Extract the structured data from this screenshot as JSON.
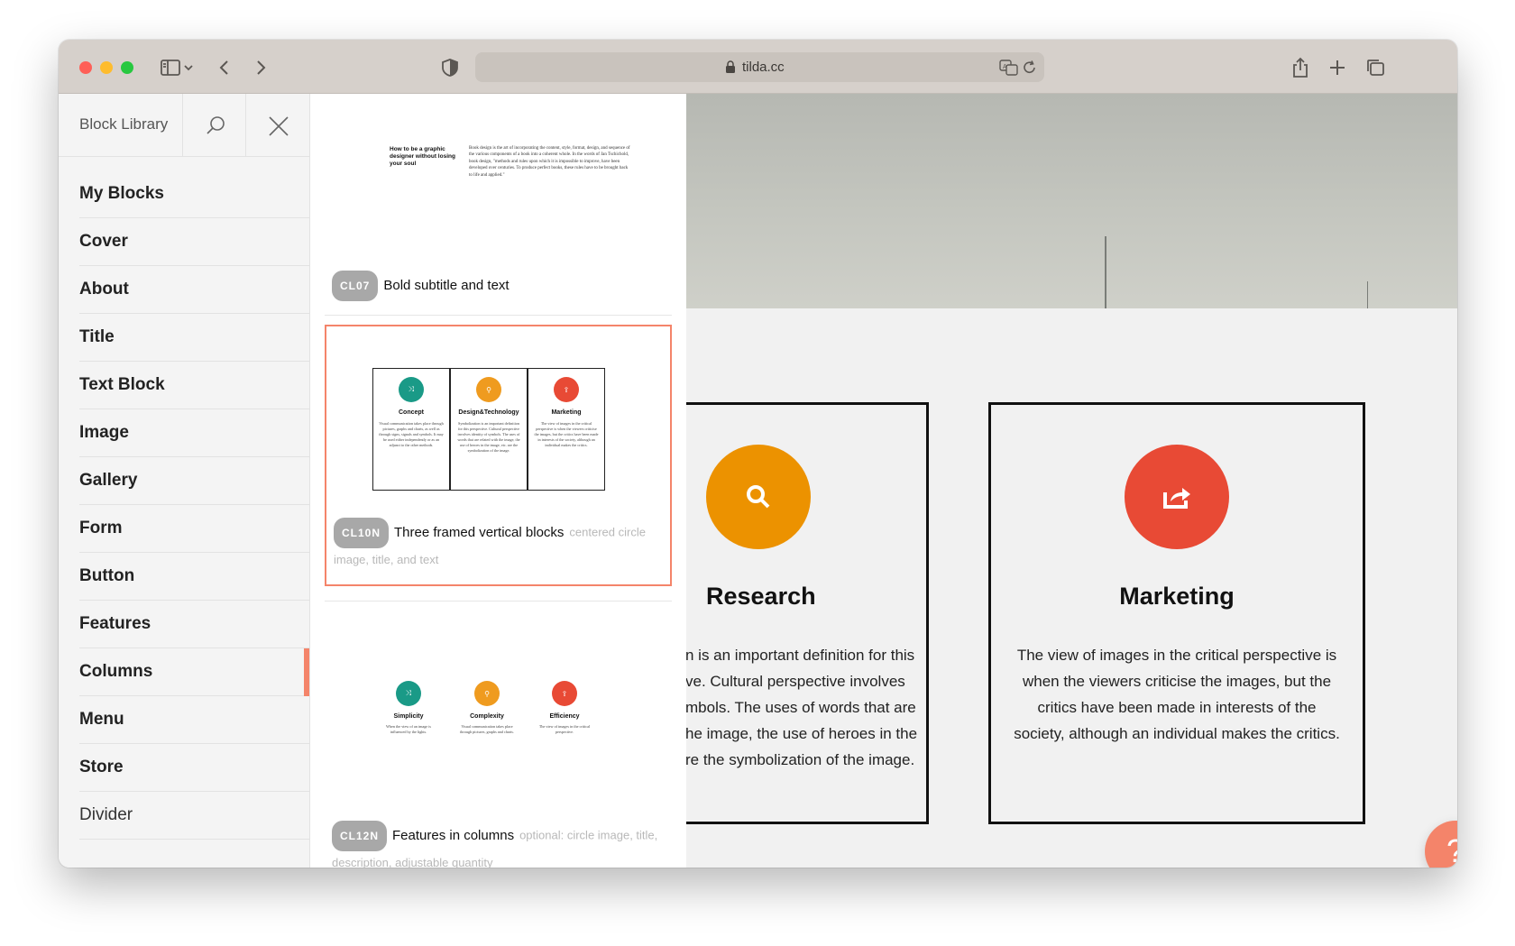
{
  "browser": {
    "url": "tilda.cc"
  },
  "sidebar": {
    "title": "Block Library",
    "items": [
      {
        "label": "My Blocks"
      },
      {
        "label": "Cover"
      },
      {
        "label": "About"
      },
      {
        "label": "Title"
      },
      {
        "label": "Text Block"
      },
      {
        "label": "Image"
      },
      {
        "label": "Gallery"
      },
      {
        "label": "Form"
      },
      {
        "label": "Button"
      },
      {
        "label": "Features"
      },
      {
        "label": "Columns",
        "active": true
      },
      {
        "label": "Menu"
      },
      {
        "label": "Store"
      },
      {
        "label": "Divider"
      }
    ]
  },
  "blocks": [
    {
      "code": "CL07",
      "title": "Bold subtitle and text",
      "description": "",
      "preview": {
        "heading": "How to be a graphic designer without losing your soul",
        "text": "Book design is the art of incorporating the content, style, format, design, and sequence of the various components of a book into a coherent whole. In the words of Jan Tschichold, book design, \"methods and rules upon which it is impossible to improve, have been developed over centuries. To produce perfect books, these rules have to be brought back to life and applied.\""
      }
    },
    {
      "code": "CL10N",
      "title": "Three framed vertical blocks",
      "description": "centered circle image, title, and text",
      "selected": true,
      "preview": {
        "items": [
          {
            "title": "Concept",
            "text": "Visual communication takes place through pictures, graphs and charts, as well as through signs, signals and symbols. It may be used either independently or as an adjunct to the other methods.",
            "color": "#1a9a87"
          },
          {
            "title": "Design&Technology",
            "text": "Symbolization is an important definition for this perspective. Cultural perspective involves identity of symbols. The uses of words that are related with the image, the use of heroes in the image, etc. are the symbolization of the image.",
            "color": "#ef9b1f"
          },
          {
            "title": "Marketing",
            "text": "The view of images in the critical perspective is when the viewers criticise the images, but the critics have been made in interests of the society, although an individual makes the critics.",
            "color": "#e84a35"
          }
        ]
      }
    },
    {
      "code": "CL12N",
      "title": "Features in columns",
      "description": "optional: circle image, title, description, adjustable quantity",
      "preview": {
        "items": [
          {
            "title": "Simplicity",
            "text": "When the view of an image is influenced by the lights.",
            "color": "#1a9a87"
          },
          {
            "title": "Complexity",
            "text": "Visual communication takes place through pictures, graphs and charts.",
            "color": "#ef9b1f"
          },
          {
            "title": "Efficiency",
            "text": "The view of images in the critical perspective.",
            "color": "#e84a35"
          }
        ]
      }
    }
  ],
  "canvas": {
    "columns": [
      {
        "title": "Research",
        "color": "#ec9200",
        "icon": "search-icon",
        "lines": [
          "n is an important definition for this",
          "ve. Cultural perspective involves",
          "mbols. The uses of words that are",
          "he image, the use of heroes in the",
          "re the symbolization of the image."
        ]
      },
      {
        "title": "Marketing",
        "color": "#e84a35",
        "icon": "share-icon",
        "lines": [
          "The view of images in the critical perspective is",
          "when the viewers criticise the images, but the",
          "critics have been made in interests of the",
          "society, although an individual makes the critics."
        ]
      }
    ],
    "help_label": "?"
  },
  "colors": {
    "accent": "#f4846a",
    "teal": "#1a9a87",
    "orange": "#ec9200",
    "red": "#e84a35"
  }
}
